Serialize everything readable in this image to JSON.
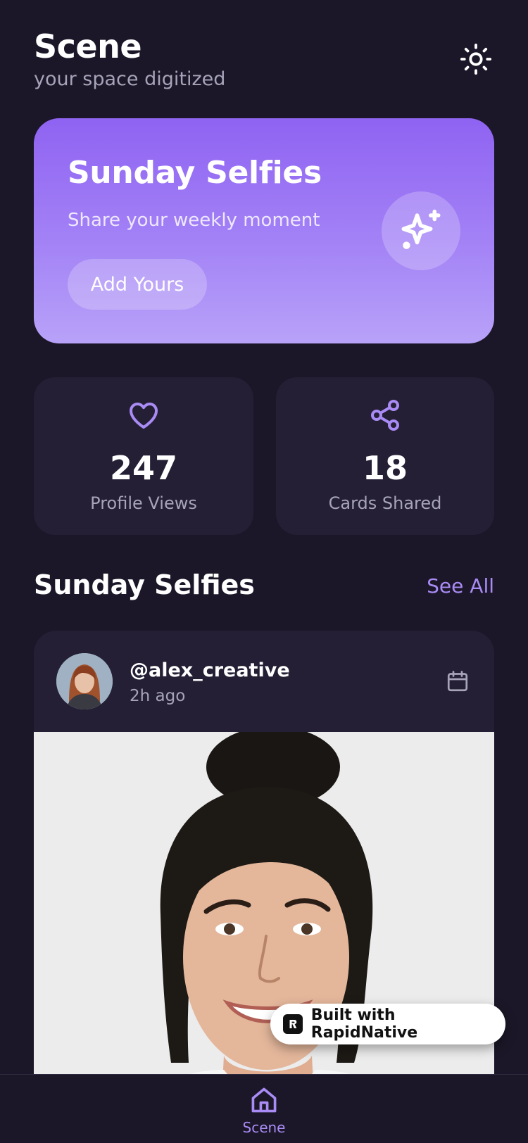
{
  "header": {
    "title": "Scene",
    "subtitle": "your space digitized",
    "theme_icon": "sun-icon"
  },
  "hero": {
    "title": "Sunday Selfies",
    "subtitle": "Share your weekly moment",
    "button_label": "Add Yours",
    "icon": "sparkles-icon",
    "gradient_start": "#8f63f2",
    "gradient_end": "#b8a2f8"
  },
  "stats": [
    {
      "icon": "heart-icon",
      "value": "247",
      "label": "Profile Views"
    },
    {
      "icon": "share-icon",
      "value": "18",
      "label": "Cards Shared"
    }
  ],
  "section": {
    "title": "Sunday Selfies",
    "see_all_label": "See All"
  },
  "post": {
    "username": "@alex_creative",
    "time": "2h ago",
    "action_icon": "calendar-icon"
  },
  "badge": {
    "label": "Built with RapidNative"
  },
  "bottom_nav": {
    "items": [
      {
        "label": "Scene",
        "icon": "home-icon",
        "active": true
      }
    ]
  },
  "colors": {
    "background": "#1b1728",
    "card": "#241f34",
    "accent": "#a98bf5",
    "muted_text": "#a7a3b8"
  }
}
